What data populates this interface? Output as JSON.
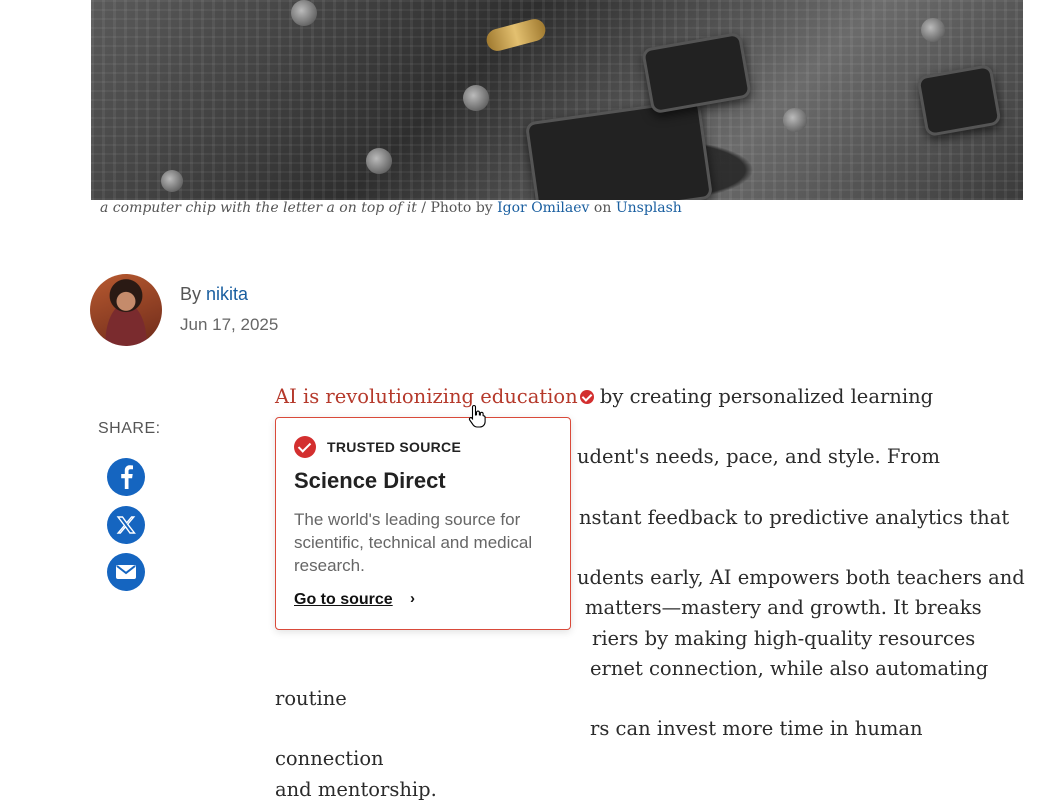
{
  "hero": {
    "caption_italic": "a computer chip with the letter a on top of it",
    "caption_sep": " / Photo by ",
    "photographer": "Igor Omilaev",
    "caption_on": " on ",
    "source": "Unsplash"
  },
  "author": {
    "by": "By ",
    "name": "nikita",
    "date": "Jun 17, 2025"
  },
  "share": {
    "label": "SHARE:",
    "icons": [
      "facebook-icon",
      "x-icon",
      "mail-icon"
    ],
    "color": "#1565c0"
  },
  "article": {
    "link_text": "AI is revolutionizing education",
    "lines": [
      " by creating personalized learning experiences",
      "udent's needs, pace, and style. From intelligent",
      "nstant feedback to predictive analytics that help",
      "udents early, AI empowers both teachers and",
      "matters—mastery and growth. It breaks",
      "riers by making high-quality resources",
      "ernet connection, while also automating routine",
      "rs can invest more time in human connection",
      "and mentorship."
    ],
    "link_color": "#b5392b"
  },
  "popover": {
    "badge": "TRUSTED SOURCE",
    "title": "Science Direct",
    "description": "The world's leading source for scientific, technical and medical research.",
    "link": "Go to source",
    "accent": "#d32f2f"
  }
}
